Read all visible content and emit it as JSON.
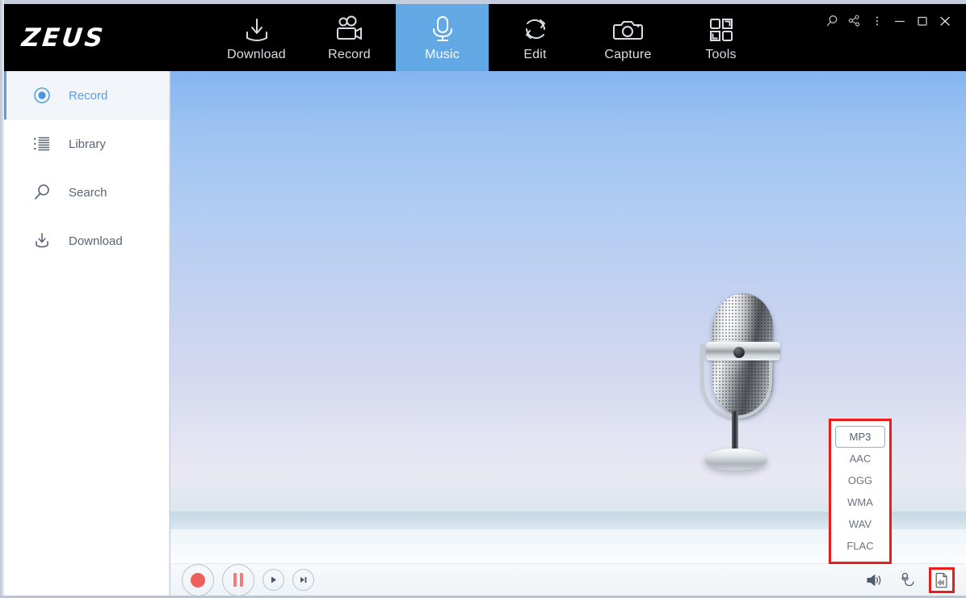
{
  "app": {
    "name": "ZEUS",
    "logo_text": "ZEUS"
  },
  "header": {
    "tabs": [
      {
        "label": "Download",
        "icon": "download-tray-icon",
        "active": false
      },
      {
        "label": "Record",
        "icon": "video-camera-icon",
        "active": false
      },
      {
        "label": "Music",
        "icon": "microphone-icon",
        "active": true
      },
      {
        "label": "Edit",
        "icon": "refresh-arrows-icon",
        "active": false
      },
      {
        "label": "Capture",
        "icon": "camera-icon",
        "active": false
      },
      {
        "label": "Tools",
        "icon": "grid-squares-icon",
        "active": false
      }
    ],
    "window_controls": [
      {
        "name": "search-icon",
        "glyph": "search"
      },
      {
        "name": "share-icon",
        "glyph": "share"
      },
      {
        "name": "more-menu-icon",
        "glyph": "kebab"
      },
      {
        "name": "minimize-icon",
        "glyph": "minimize"
      },
      {
        "name": "maximize-icon",
        "glyph": "maximize"
      },
      {
        "name": "close-icon",
        "glyph": "close"
      }
    ]
  },
  "sidebar": {
    "items": [
      {
        "label": "Record",
        "icon": "record-circle-icon",
        "active": true
      },
      {
        "label": "Library",
        "icon": "list-icon",
        "active": false
      },
      {
        "label": "Search",
        "icon": "magnifier-icon",
        "active": false
      },
      {
        "label": "Download",
        "icon": "download-icon",
        "active": false
      }
    ]
  },
  "stage": {
    "illustration": "vintage-microphone"
  },
  "format_menu": {
    "options": [
      "MP3",
      "AAC",
      "OGG",
      "WMA",
      "WAV",
      "FLAC"
    ],
    "selected": "MP3",
    "highlight_color": "#ec1c19"
  },
  "bottom_bar": {
    "transport": [
      {
        "name": "record-button",
        "label": "Record"
      },
      {
        "name": "pause-button",
        "label": "Pause"
      },
      {
        "name": "play-button",
        "label": "Play"
      },
      {
        "name": "next-button",
        "label": "Next"
      }
    ],
    "tools": [
      {
        "name": "speaker-volume-icon",
        "label": "Speaker"
      },
      {
        "name": "microphone-input-icon",
        "label": "Microphone"
      },
      {
        "name": "output-format-icon",
        "label": "Output format",
        "highlighted": true
      }
    ]
  },
  "colors": {
    "accent_blue": "#62a8e5",
    "sidebar_active_blue": "#5a9fe0",
    "header_black": "#000000",
    "highlight_red": "#ec1c19",
    "record_red": "#ed5f5a"
  }
}
